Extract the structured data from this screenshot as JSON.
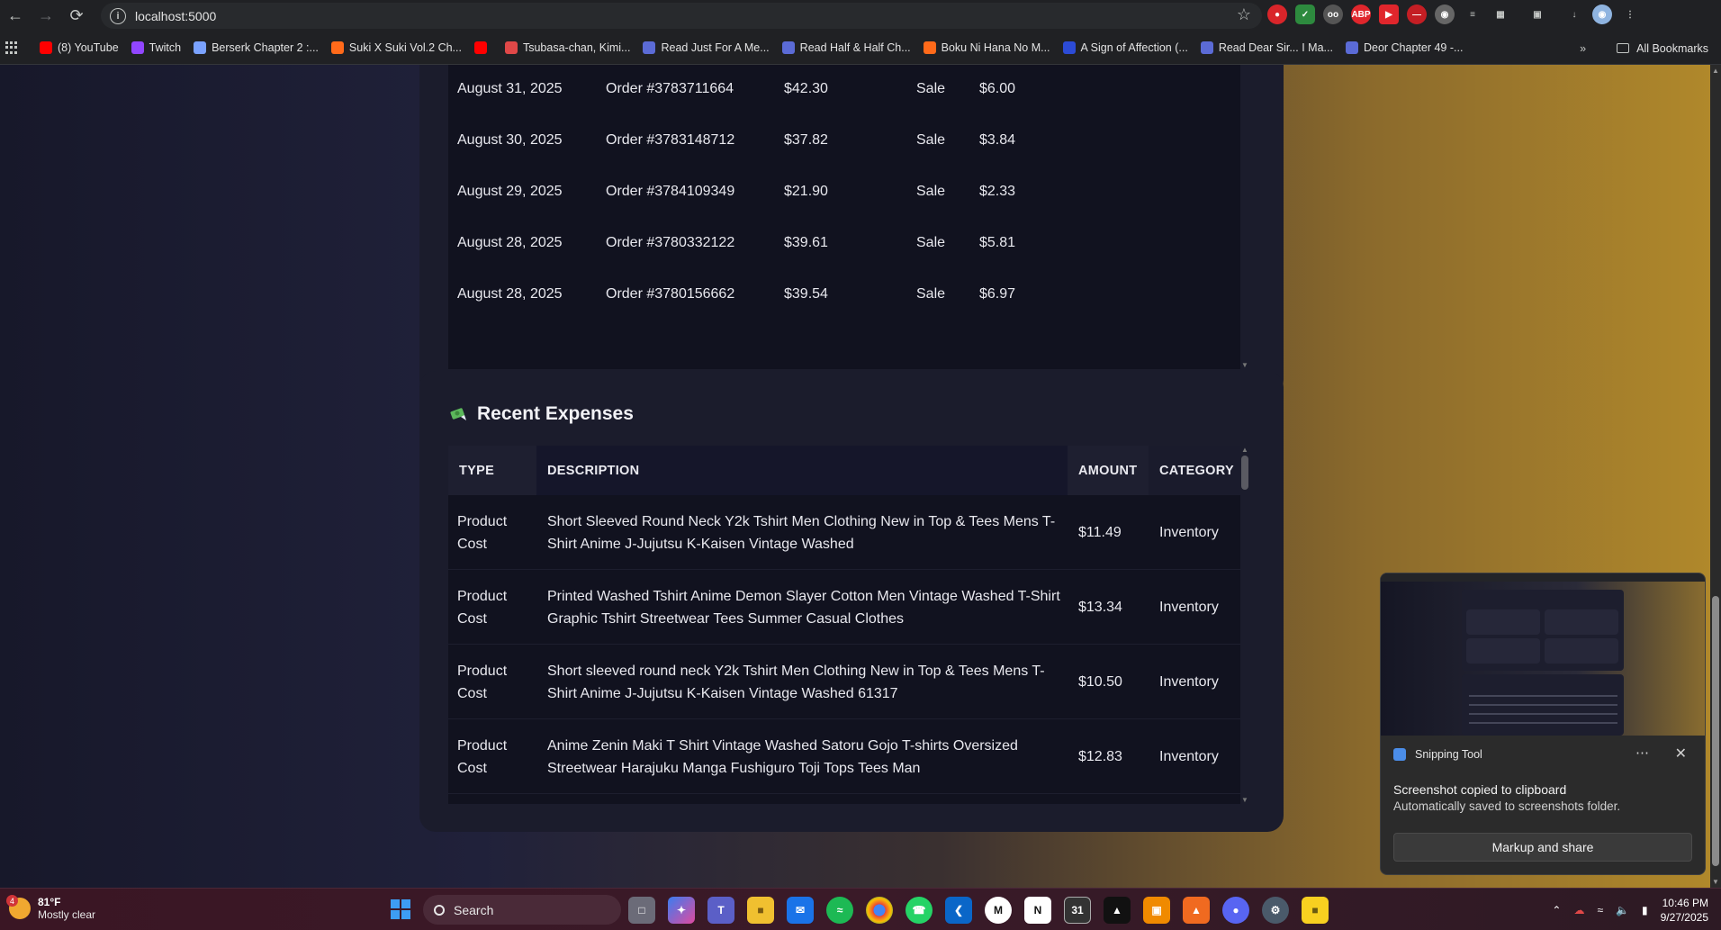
{
  "browser": {
    "url": "localhost:5000",
    "bookmarks": [
      {
        "label": "(8) YouTube",
        "color": "#ff0000"
      },
      {
        "label": "Twitch",
        "color": "#9146ff"
      },
      {
        "label": "Berserk Chapter 2 :...",
        "color": "#7aa2ff"
      },
      {
        "label": "Suki X Suki Vol.2 Ch...",
        "color": "#ff6a1a"
      },
      {
        "label": "",
        "color": "#ff0000"
      },
      {
        "label": "Tsubasa-chan, Kimi...",
        "color": "#e04848"
      },
      {
        "label": "Read Just For A Me...",
        "color": "#5b6bd6"
      },
      {
        "label": "Read Half & Half Ch...",
        "color": "#5b6bd6"
      },
      {
        "label": "Boku Ni Hana No M...",
        "color": "#ff6a1a"
      },
      {
        "label": "A Sign of Affection (...",
        "color": "#2c4bd6"
      },
      {
        "label": "Read Dear Sir... I Ma...",
        "color": "#5b6bd6"
      },
      {
        "label": "Deor Chapter 49 -...",
        "color": "#5b6bd6"
      }
    ],
    "all_bookmarks": "All Bookmarks"
  },
  "sales": {
    "rows": [
      {
        "date": "August 31, 2025",
        "order": "Order #3783711664",
        "amount": "$42.30",
        "type": "Sale",
        "fee": "$6.00"
      },
      {
        "date": "August 30, 2025",
        "order": "Order #3783148712",
        "amount": "$37.82",
        "type": "Sale",
        "fee": "$3.84"
      },
      {
        "date": "August 29, 2025",
        "order": "Order #3784109349",
        "amount": "$21.90",
        "type": "Sale",
        "fee": "$2.33"
      },
      {
        "date": "August 28, 2025",
        "order": "Order #3780332122",
        "amount": "$39.61",
        "type": "Sale",
        "fee": "$5.81"
      },
      {
        "date": "August 28, 2025",
        "order": "Order #3780156662",
        "amount": "$39.54",
        "type": "Sale",
        "fee": "$6.97"
      }
    ]
  },
  "expenses": {
    "title": "Recent Expenses",
    "icon": "money-wings-icon",
    "headers": {
      "type": "TYPE",
      "description": "DESCRIPTION",
      "amount": "AMOUNT",
      "category": "CATEGORY"
    },
    "rows": [
      {
        "type_line1": "Product",
        "type_line2": "Cost",
        "desc_line1": "Short Sleeved Round Neck Y2k Tshirt Men Clothing New in Top & Tees Mens T-",
        "desc_line2": "Shirt Anime J-Jujutsu K-Kaisen Vintage Washed",
        "amount": "$11.49",
        "category": "Inventory"
      },
      {
        "type_line1": "Product",
        "type_line2": "Cost",
        "desc_line1": "Printed Washed Tshirt Anime Demon Slayer Cotton Men Vintage Washed T-Shirt",
        "desc_line2": "Graphic Tshirt Streetwear Tees Summer Casual Clothes",
        "amount": "$13.34",
        "category": "Inventory"
      },
      {
        "type_line1": "Product",
        "type_line2": "Cost",
        "desc_line1": "Short sleeved round neck Y2k Tshirt Men Clothing New in Top & Tees Mens T-",
        "desc_line2": "Shirt Anime J-Jujutsu K-Kaisen Vintage Washed 61317",
        "amount": "$10.50",
        "category": "Inventory"
      },
      {
        "type_line1": "Product",
        "type_line2": "Cost",
        "desc_line1": "Anime Zenin Maki T Shirt Vintage Washed Satoru Gojo T-shirts Oversized",
        "desc_line2": "Streetwear Harajuku Manga Fushiguro Toji Tops Tees Man",
        "amount": "$12.83",
        "category": "Inventory"
      }
    ]
  },
  "toast": {
    "app": "Snipping Tool",
    "message": "Screenshot copied to clipboard",
    "detail": "Automatically saved to screenshots folder.",
    "button": "Markup and share"
  },
  "taskbar": {
    "temperature": "81°F",
    "weather": "Mostly clear",
    "weather_badge": "4",
    "search": "Search",
    "time": "10:46 PM",
    "date": "9/27/2025"
  }
}
